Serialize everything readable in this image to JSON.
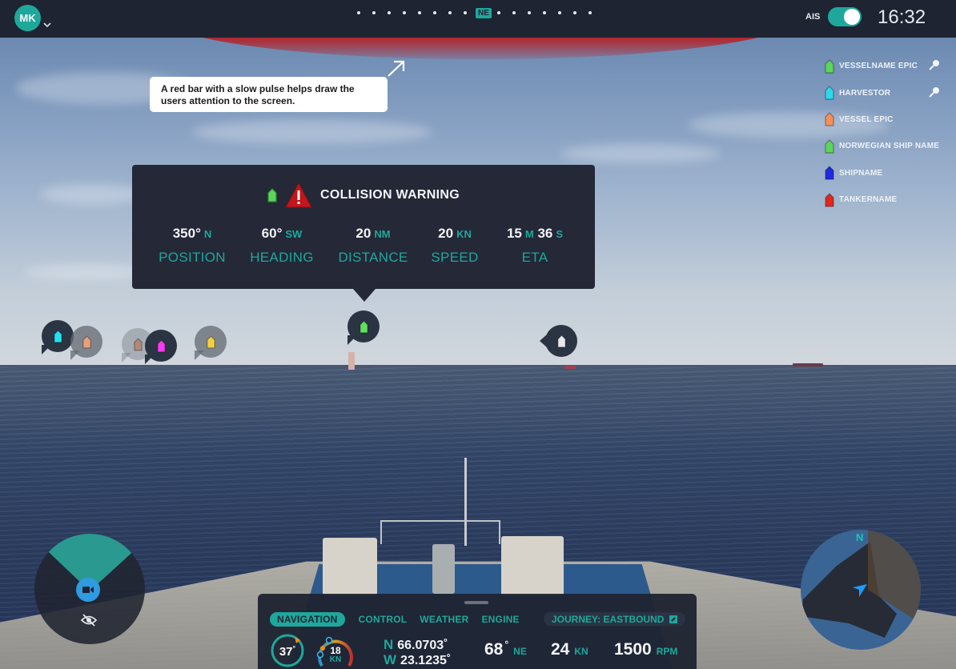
{
  "topbar": {
    "user_initials": "MK",
    "compass_heading": "NE",
    "compass_ticks_left": 8,
    "compass_ticks_right": 7,
    "ais_label": "AIS",
    "ais_enabled": true,
    "time": "16:32"
  },
  "alert_bar": {
    "color": "#b81c22"
  },
  "annotation": {
    "text": "A red bar with a slow pulse helps draw the users attention to the screen."
  },
  "vessel_list": [
    {
      "name": "VESSELNAME EPIC",
      "color": "#5fd35f",
      "pinned": true,
      "pin_icon": "pin-icon"
    },
    {
      "name": "HARVESTOR",
      "color": "#2fd6e8",
      "pinned": true,
      "pin_icon": "pin-icon"
    },
    {
      "name": "VESSEL EPIC",
      "color": "#f2905a",
      "pinned": false
    },
    {
      "name": "NORWEGIAN SHIP NAME",
      "color": "#5fd35f",
      "pinned": false
    },
    {
      "name": "SHIPNAME",
      "color": "#1f2ae0",
      "pinned": false
    },
    {
      "name": "TANKERNAME",
      "color": "#e0281c",
      "pinned": false
    }
  ],
  "collision_warning": {
    "title": "COLLISION WARNING",
    "vessel_color": "#5fd35f",
    "warning_color": "#c0171c",
    "stats": [
      {
        "value": "350°",
        "unit": "N",
        "label": "POSITION"
      },
      {
        "value": "60°",
        "unit": "SW",
        "label": "HEADING"
      },
      {
        "value": "20",
        "unit": "NM",
        "label": "DISTANCE"
      },
      {
        "value": "20",
        "unit": "KN",
        "label": "SPEED"
      },
      {
        "value": "15",
        "unit": "M",
        "value2": "36",
        "unit2": "S",
        "label": "ETA"
      }
    ]
  },
  "ais_markers": [
    {
      "color": "#23e0f0",
      "style": "active"
    },
    {
      "color": "#e8a07a",
      "style": "faded"
    },
    {
      "color": "#b08a78",
      "style": "ghost"
    },
    {
      "color": "#f23cf0",
      "style": "active"
    },
    {
      "color": "#f2d040",
      "style": "faded"
    },
    {
      "color": "#5fe05f",
      "style": "active"
    },
    {
      "color": "#e8e8e8",
      "style": "active"
    }
  ],
  "camera_control": {
    "camera_icon": "video-camera-icon",
    "visibility_icon": "eye-off-icon"
  },
  "minimap": {
    "north_label": "N"
  },
  "dashboard": {
    "tabs": [
      {
        "label": "NAVIGATION",
        "active": true
      },
      {
        "label": "CONTROL",
        "active": false
      },
      {
        "label": "WEATHER",
        "active": false
      },
      {
        "label": "ENGINE",
        "active": false
      }
    ],
    "journey_label": "JOURNEY: EASTBOUND",
    "rudder_angle": "37",
    "rudder_angle_degree": "°",
    "speed_gauge_value": "18",
    "speed_gauge_unit": "KN",
    "lat_dir": "N",
    "lat": "66.0703˚",
    "lon_dir": "W",
    "lon": "23.1235˚",
    "heading_value": "68",
    "heading_dir": "NE",
    "speed_value": "24",
    "speed_unit": "KN",
    "rpm_value": "1500",
    "rpm_unit": "RPM"
  }
}
